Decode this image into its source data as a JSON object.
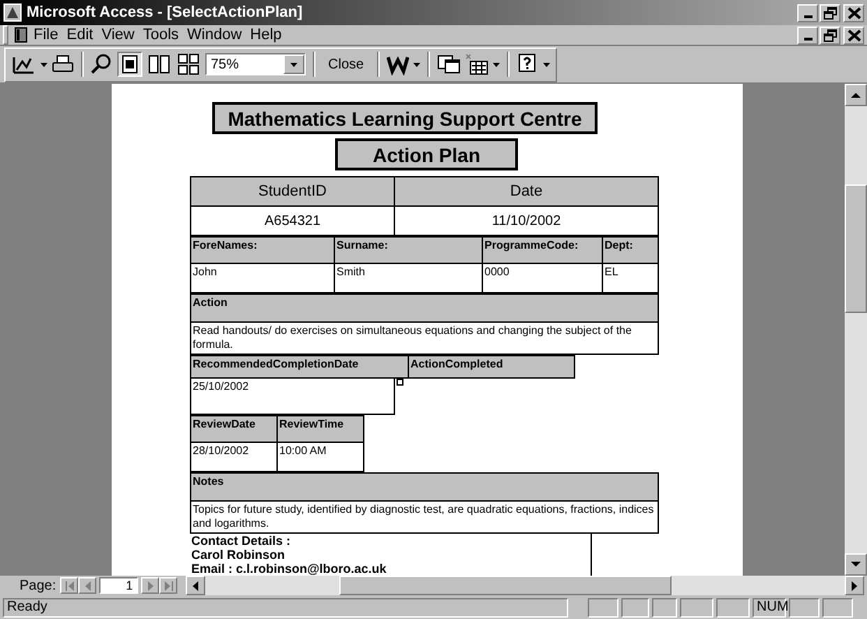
{
  "window": {
    "title": "Microsoft Access - [SelectActionPlan]"
  },
  "menu": [
    "File",
    "Edit",
    "View",
    "Tools",
    "Window",
    "Help"
  ],
  "toolbar": {
    "zoom": "75%",
    "close_button": "Close",
    "view_buttons": [
      {
        "kind": "one-page",
        "selected": true
      },
      {
        "kind": "two-pages",
        "selected": false
      },
      {
        "kind": "multiple-pages",
        "selected": false
      }
    ]
  },
  "report": {
    "title": "Mathematics Learning Support Centre",
    "subtitle": "Action Plan",
    "header_fields": [
      {
        "label": "StudentID",
        "value": "A654321"
      },
      {
        "label": "Date",
        "value": "11/10/2002"
      }
    ],
    "name_fields": [
      {
        "label": "ForeNames:",
        "value": "John"
      },
      {
        "label": "Surname:",
        "value": "Smith"
      },
      {
        "label": "ProgrammeCode:",
        "value": "0000"
      },
      {
        "label": "Dept:",
        "value": "EL"
      }
    ],
    "action": {
      "label": "Action",
      "value": "Read handouts/ do exercises on simultaneous equations and changing the subject of the formula."
    },
    "completion": {
      "date_label": "RecommendedCompletionDate",
      "date_value": "25/10/2002",
      "completed_label": "ActionCompleted",
      "completed": false
    },
    "review": [
      {
        "label": "ReviewDate",
        "value": "28/10/2002"
      },
      {
        "label": "ReviewTime",
        "value": "10:00 AM"
      }
    ],
    "notes": {
      "label": "Notes",
      "value": "Topics for future study, identified by diagnostic test, are quadratic equations, fractions, indices and logarithms."
    },
    "contact": [
      "Contact Details :",
      "Carol Robinson",
      "Email : c.l.robinson@lboro.ac.uk"
    ]
  },
  "navigation": {
    "label": "Page:",
    "page": "1"
  },
  "status_bar": {
    "text": "Ready",
    "num_lock": "NUM"
  }
}
